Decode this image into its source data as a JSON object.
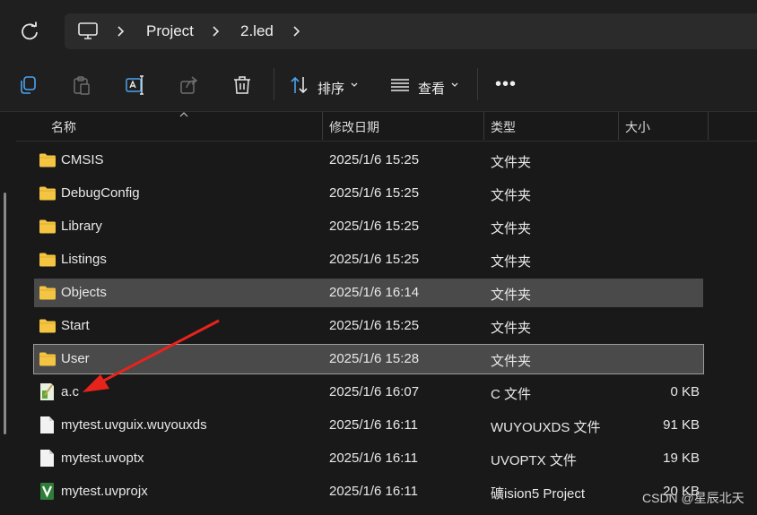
{
  "address_bar": {
    "breadcrumbs": [
      "Project",
      "2.led"
    ],
    "pc_icon": "computer-icon",
    "refresh_icon": "refresh-icon"
  },
  "toolbar": {
    "icons": [
      "copy-icon",
      "paste-icon",
      "rename-icon",
      "share-icon",
      "delete-icon"
    ],
    "sort_label": "排序",
    "view_label": "查看",
    "more_label": "•••"
  },
  "columns": {
    "name": "名称",
    "modified": "修改日期",
    "type": "类型",
    "size": "大小"
  },
  "files": [
    {
      "name": "CMSIS",
      "modified": "2025/1/6 15:25",
      "type": "文件夹",
      "size": "",
      "icon": "folder-icon",
      "state": ""
    },
    {
      "name": "DebugConfig",
      "modified": "2025/1/6 15:25",
      "type": "文件夹",
      "size": "",
      "icon": "folder-icon",
      "state": ""
    },
    {
      "name": "Library",
      "modified": "2025/1/6 15:25",
      "type": "文件夹",
      "size": "",
      "icon": "folder-icon",
      "state": ""
    },
    {
      "name": "Listings",
      "modified": "2025/1/6 15:25",
      "type": "文件夹",
      "size": "",
      "icon": "folder-icon",
      "state": ""
    },
    {
      "name": "Objects",
      "modified": "2025/1/6 16:14",
      "type": "文件夹",
      "size": "",
      "icon": "folder-icon",
      "state": "hover"
    },
    {
      "name": "Start",
      "modified": "2025/1/6 15:25",
      "type": "文件夹",
      "size": "",
      "icon": "folder-icon",
      "state": ""
    },
    {
      "name": "User",
      "modified": "2025/1/6 15:28",
      "type": "文件夹",
      "size": "",
      "icon": "folder-icon",
      "state": "selected"
    },
    {
      "name": "a.c",
      "modified": "2025/1/6 16:07",
      "type": "C 文件",
      "size": "0 KB",
      "icon": "c-file-icon",
      "state": ""
    },
    {
      "name": "mytest.uvguix.wuyouxds",
      "modified": "2025/1/6 16:11",
      "type": "WUYOUXDS 文件",
      "size": "91 KB",
      "icon": "file-icon",
      "state": ""
    },
    {
      "name": "mytest.uvoptx",
      "modified": "2025/1/6 16:11",
      "type": "UVOPTX 文件",
      "size": "19 KB",
      "icon": "file-icon",
      "state": ""
    },
    {
      "name": "mytest.uvprojx",
      "modified": "2025/1/6 16:11",
      "type": "礦ision5 Project",
      "size": "20 KB",
      "icon": "keil-project-icon",
      "state": ""
    }
  ],
  "annotation": {
    "arrow_color": "#e8231c"
  },
  "watermark": "CSDN @星辰北天",
  "colors": {
    "folder": "#f4c542",
    "background": "#191919",
    "selection": "#4a4a4a"
  }
}
